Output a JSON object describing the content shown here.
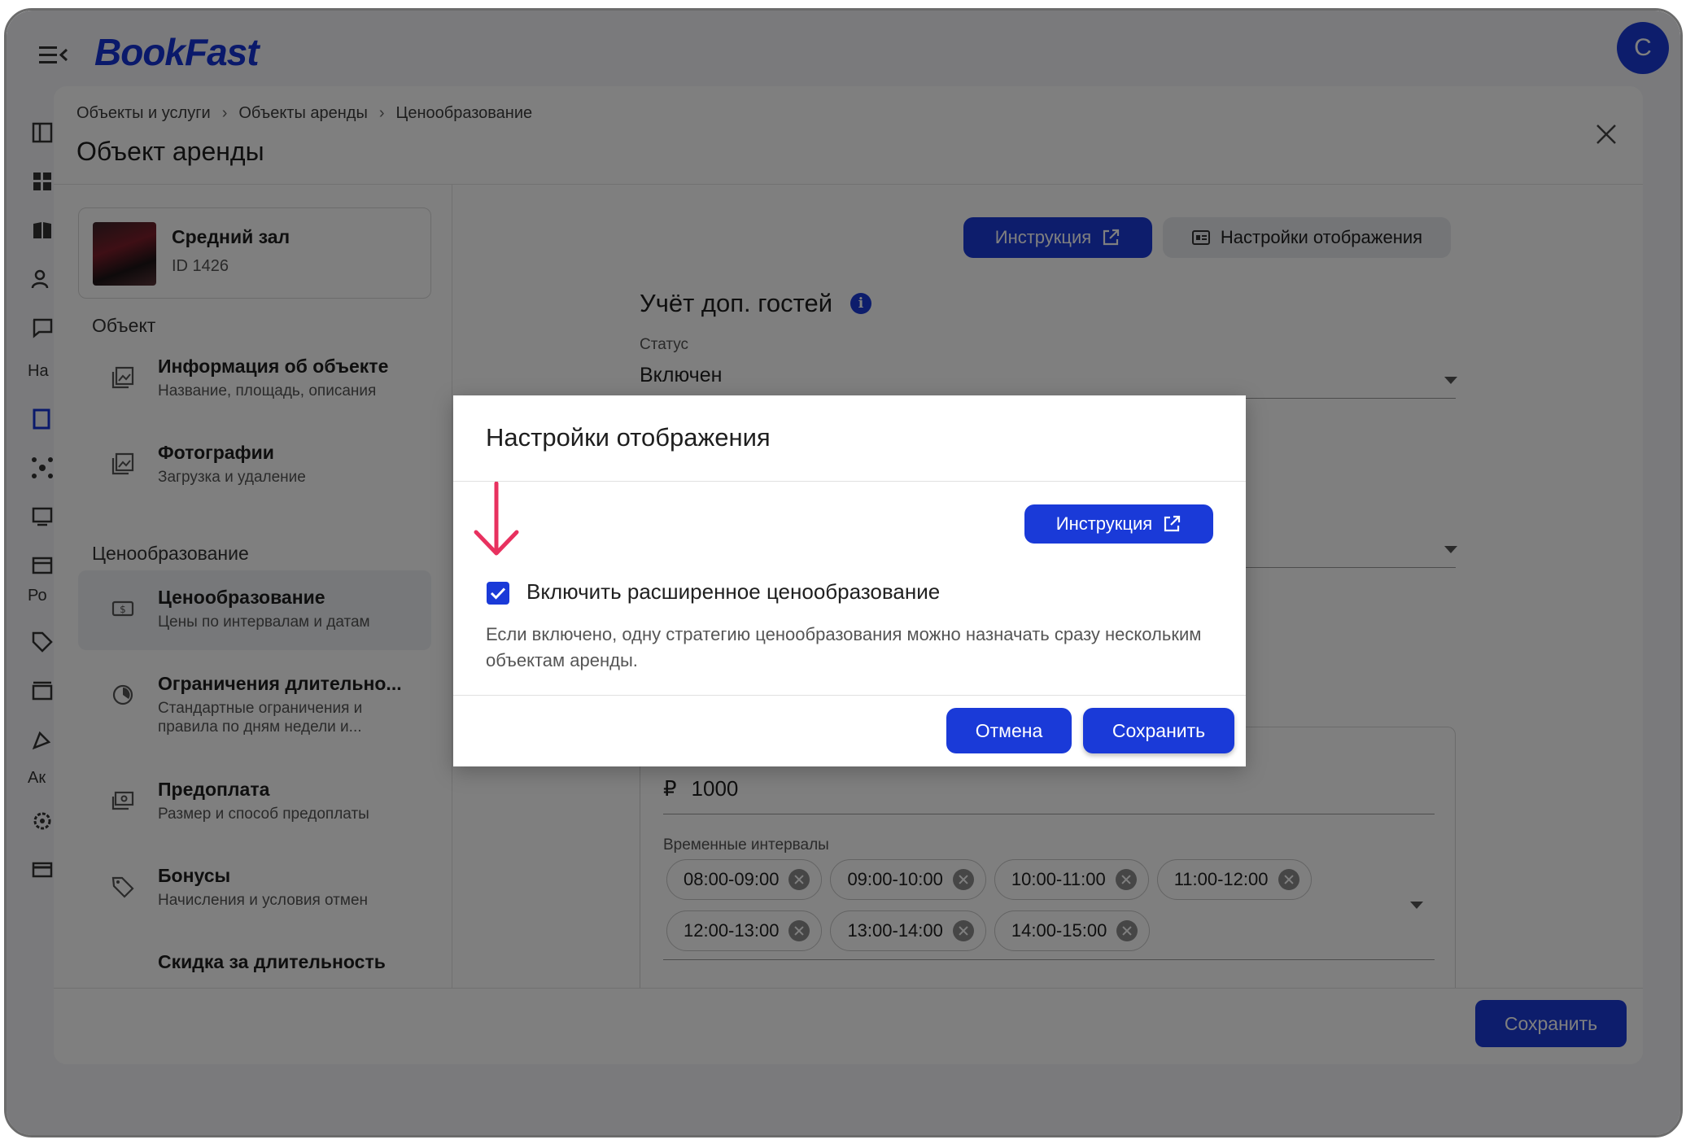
{
  "app": {
    "logo": "BookFast",
    "avatar_initial": "C"
  },
  "rail": {
    "labels": [
      "На",
      "Ро",
      "Ак"
    ]
  },
  "page": {
    "breadcrumb": [
      "Объекты и услуги",
      "Объекты аренды",
      "Ценообразование"
    ],
    "title": "Объект аренды"
  },
  "object": {
    "name": "Средний зал",
    "id": "ID 1426"
  },
  "nav": {
    "section_object": "Объект",
    "section_pricing": "Ценообразование",
    "items": [
      {
        "title": "Информация об объекте",
        "sub": "Название, площадь, описания"
      },
      {
        "title": "Фотографии",
        "sub": "Загрузка и удаление"
      },
      {
        "title": "Ценообразование",
        "sub": "Цены по интервалам и датам"
      },
      {
        "title": "Ограничения длительно...",
        "sub": "Стандартные ограничения и правила по дням недели и..."
      },
      {
        "title": "Предоплата",
        "sub": "Размер и способ предоплаты"
      },
      {
        "title": "Бонусы",
        "sub": "Начисления и условия отмен"
      },
      {
        "title": "Скидка за длительность"
      }
    ]
  },
  "content": {
    "instruction_label": "Инструкция",
    "display_settings_label": "Настройки отображения",
    "section_title": "Учёт доп. гостей",
    "status_label": "Статус",
    "status_value": "Включен",
    "currency": "₽",
    "price": "1000",
    "intervals_label": "Временные интервалы",
    "intervals": [
      "08:00-09:00",
      "09:00-10:00",
      "10:00-11:00",
      "11:00-12:00",
      "12:00-13:00",
      "13:00-14:00",
      "14:00-15:00"
    ],
    "save_label": "Сохранить"
  },
  "dialog": {
    "title": "Настройки отображения",
    "instruction_label": "Инструкция",
    "checkbox_label": "Включить расширенное ценообразование",
    "checkbox_checked": true,
    "description": "Если включено, одну стратегию ценообразования можно назначать сразу нескольким объектам аренды.",
    "cancel_label": "Отмена",
    "save_label": "Сохранить"
  },
  "colors": {
    "accent": "#1a3ad8",
    "annotation_arrow": "#e8315f"
  }
}
